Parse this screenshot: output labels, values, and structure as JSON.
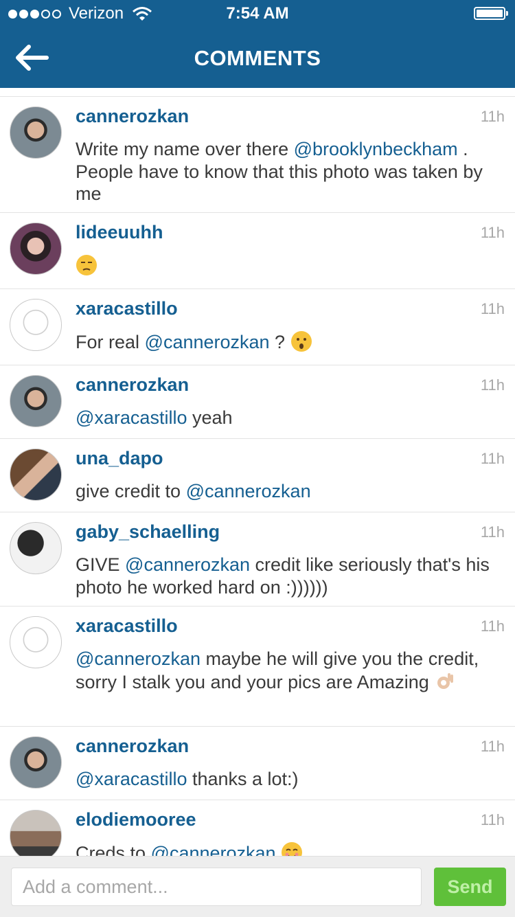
{
  "status": {
    "carrier": "Verizon",
    "time": "7:54 AM",
    "signal_bars": 3,
    "signal_total": 5
  },
  "nav": {
    "title": "COMMENTS"
  },
  "comments": [
    {
      "user": "cannerozkan",
      "ago": "11h",
      "segments": [
        {
          "t": "Write my name over there "
        },
        {
          "m": "@brooklynbeckham"
        },
        {
          "t": " . People have to know that this photo was taken by me"
        }
      ]
    },
    {
      "user": "lideeuuhh",
      "ago": "11h",
      "segments": [
        {
          "e": "unamused-emoji"
        }
      ]
    },
    {
      "user": "xaracastillo",
      "ago": "11h",
      "segments": [
        {
          "t": "For real "
        },
        {
          "m": "@cannerozkan"
        },
        {
          "t": " ? "
        },
        {
          "e": "surprised-emoji"
        }
      ]
    },
    {
      "user": "cannerozkan",
      "ago": "11h",
      "segments": [
        {
          "m": "@xaracastillo"
        },
        {
          "t": " yeah"
        }
      ]
    },
    {
      "user": "una_dapo",
      "ago": "11h",
      "segments": [
        {
          "t": "give credit to "
        },
        {
          "m": "@cannerozkan"
        }
      ]
    },
    {
      "user": "gaby_schaelling",
      "ago": "11h",
      "segments": [
        {
          "t": "GIVE "
        },
        {
          "m": "@cannerozkan"
        },
        {
          "t": " credit like seriously that's his photo he worked hard on :))))))"
        }
      ]
    },
    {
      "user": "xaracastillo",
      "ago": "11h",
      "segments": [
        {
          "m": "@cannerozkan"
        },
        {
          "t": " maybe he will give you the credit, sorry I stalk you and your pics are Amazing "
        },
        {
          "e": "ok-hand-emoji"
        }
      ]
    },
    {
      "user": "cannerozkan",
      "ago": "11h",
      "segments": [
        {
          "m": "@xaracastillo"
        },
        {
          "t": " thanks a lot:)"
        }
      ]
    },
    {
      "user": "elodiemooree",
      "ago": "11h",
      "segments": [
        {
          "t": "Creds to "
        },
        {
          "m": "@cannerozkan"
        },
        {
          "t": " "
        },
        {
          "e": "smiling-emoji"
        }
      ]
    }
  ],
  "composer": {
    "placeholder": "Add a comment...",
    "send_label": "Send"
  },
  "colors": {
    "brand": "#155f91",
    "send": "#5fc03a"
  }
}
